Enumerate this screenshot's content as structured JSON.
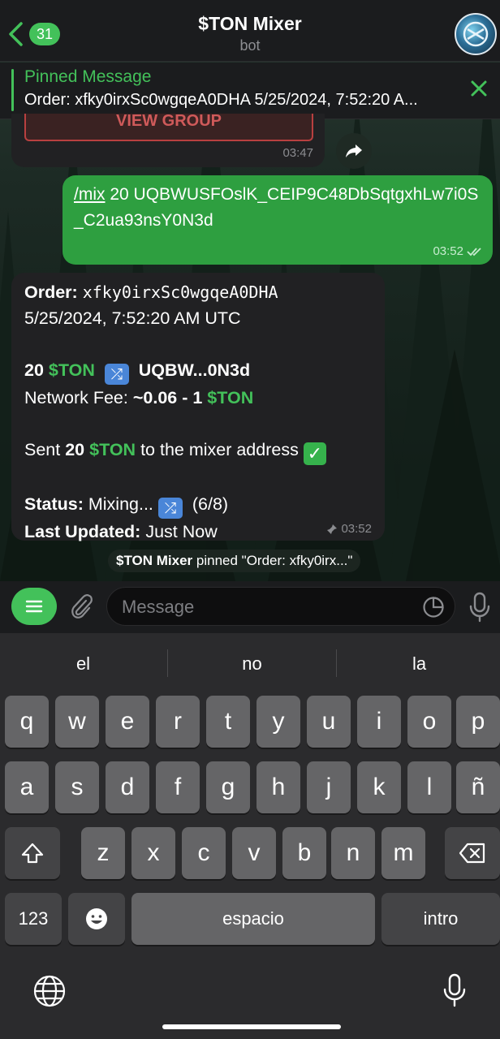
{
  "header": {
    "unread_count": "31",
    "title": "$TON Mixer",
    "subtitle": "bot"
  },
  "pinned": {
    "title": "Pinned Message",
    "text": "Order: xfky0irxSc0wgqeA0DHA 5/25/2024, 7:52:20 A..."
  },
  "messages": {
    "previous": {
      "button_label": "VIEW GROUP",
      "time": "03:47"
    },
    "outgoing": {
      "command": "/mix",
      "text": " 20 UQBWUSFOslK_CEIP9C48DbSqtgxhLw7i0S_C2ua93nsY0N3d",
      "time": "03:52"
    },
    "bot": {
      "order_label": "Order:",
      "order_id": "xfky0irxSc0wgqeA0DHA",
      "date": "5/25/2024, 7:52:20 AM UTC",
      "amount": "20",
      "currency": "$TON",
      "target": "UQBW...0N3d",
      "fee_label": "Network Fee:",
      "fee_value": "~0.06 - 1",
      "sent_prefix": "Sent",
      "sent_suffix": "to the mixer address",
      "status_label": "Status:",
      "status_value": "Mixing...",
      "status_progress": "(6/8)",
      "updated_label": "Last Updated:",
      "updated_value": "Just Now",
      "time": "03:52"
    },
    "service": {
      "actor": "$TON Mixer",
      "text": " pinned \"Order: xfky0irx...\""
    }
  },
  "input": {
    "placeholder": "Message"
  },
  "keyboard": {
    "suggestions": [
      "el",
      "no",
      "la"
    ],
    "row1": [
      "q",
      "w",
      "e",
      "r",
      "t",
      "y",
      "u",
      "i",
      "o",
      "p"
    ],
    "row2": [
      "a",
      "s",
      "d",
      "f",
      "g",
      "h",
      "j",
      "k",
      "l",
      "ñ"
    ],
    "row3": [
      "z",
      "x",
      "c",
      "v",
      "b",
      "n",
      "m"
    ],
    "numbers_label": "123",
    "space_label": "espacio",
    "return_label": "intro"
  },
  "colors": {
    "accent": "#43c15a",
    "outgoing_bubble": "#2e9f40",
    "incoming_bubble": "#212123"
  }
}
